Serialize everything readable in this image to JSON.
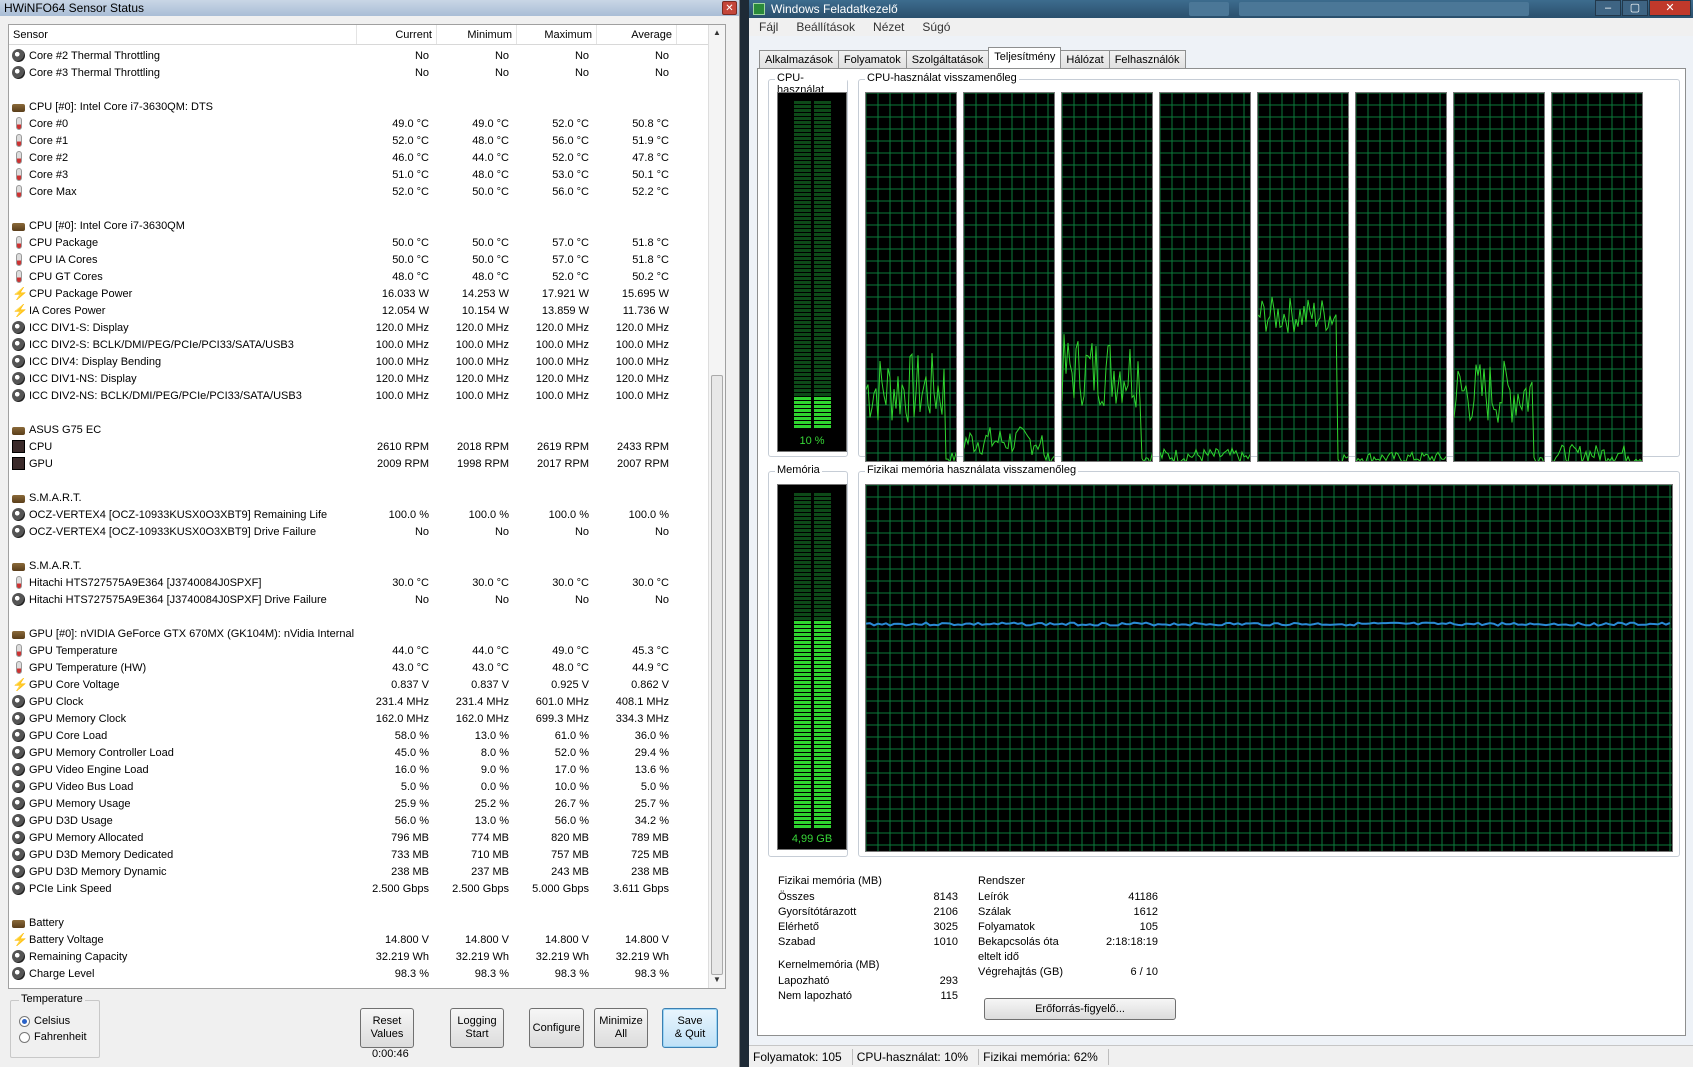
{
  "hwinfo": {
    "title": "HWiNFO64 Sensor Status",
    "columns": [
      "Sensor",
      "Current",
      "Minimum",
      "Maximum",
      "Average"
    ],
    "rows": [
      {
        "icon": "gauge",
        "name": "Core #2 Thermal Throttling",
        "cur": "No",
        "min": "No",
        "max": "No",
        "avg": "No"
      },
      {
        "icon": "gauge",
        "name": "Core #3 Thermal Throttling",
        "cur": "No",
        "min": "No",
        "max": "No",
        "avg": "No"
      },
      {
        "blank": true
      },
      {
        "icon": "chip",
        "name": "CPU [#0]: Intel Core i7-3630QM: DTS"
      },
      {
        "icon": "therm",
        "name": "Core #0",
        "cur": "49.0 °C",
        "min": "49.0 °C",
        "max": "52.0 °C",
        "avg": "50.8 °C"
      },
      {
        "icon": "therm",
        "name": "Core #1",
        "cur": "52.0 °C",
        "min": "48.0 °C",
        "max": "56.0 °C",
        "avg": "51.9 °C"
      },
      {
        "icon": "therm",
        "name": "Core #2",
        "cur": "46.0 °C",
        "min": "44.0 °C",
        "max": "52.0 °C",
        "avg": "47.8 °C"
      },
      {
        "icon": "therm",
        "name": "Core #3",
        "cur": "51.0 °C",
        "min": "48.0 °C",
        "max": "53.0 °C",
        "avg": "50.1 °C"
      },
      {
        "icon": "therm",
        "name": "Core Max",
        "cur": "52.0 °C",
        "min": "50.0 °C",
        "max": "56.0 °C",
        "avg": "52.2 °C"
      },
      {
        "blank": true
      },
      {
        "icon": "chip",
        "name": "CPU [#0]: Intel Core i7-3630QM"
      },
      {
        "icon": "therm",
        "name": "CPU Package",
        "cur": "50.0 °C",
        "min": "50.0 °C",
        "max": "57.0 °C",
        "avg": "51.8 °C"
      },
      {
        "icon": "therm",
        "name": "CPU IA Cores",
        "cur": "50.0 °C",
        "min": "50.0 °C",
        "max": "57.0 °C",
        "avg": "51.8 °C"
      },
      {
        "icon": "therm",
        "name": "CPU GT Cores",
        "cur": "48.0 °C",
        "min": "48.0 °C",
        "max": "52.0 °C",
        "avg": "50.2 °C"
      },
      {
        "icon": "bolt",
        "name": "CPU Package Power",
        "cur": "16.033 W",
        "min": "14.253 W",
        "max": "17.921 W",
        "avg": "15.695 W"
      },
      {
        "icon": "bolt",
        "name": "IA Cores Power",
        "cur": "12.054 W",
        "min": "10.154 W",
        "max": "13.859 W",
        "avg": "11.736 W"
      },
      {
        "icon": "gauge",
        "name": "ICC DIV1-S: Display",
        "cur": "120.0 MHz",
        "min": "120.0 MHz",
        "max": "120.0 MHz",
        "avg": "120.0 MHz"
      },
      {
        "icon": "gauge",
        "name": "ICC DIV2-S: BCLK/DMI/PEG/PCIe/PCI33/SATA/USB3",
        "cur": "100.0 MHz",
        "min": "100.0 MHz",
        "max": "100.0 MHz",
        "avg": "100.0 MHz"
      },
      {
        "icon": "gauge",
        "name": "ICC DIV4: Display Bending",
        "cur": "100.0 MHz",
        "min": "100.0 MHz",
        "max": "100.0 MHz",
        "avg": "100.0 MHz"
      },
      {
        "icon": "gauge",
        "name": "ICC DIV1-NS: Display",
        "cur": "120.0 MHz",
        "min": "120.0 MHz",
        "max": "120.0 MHz",
        "avg": "120.0 MHz"
      },
      {
        "icon": "gauge",
        "name": "ICC DIV2-NS: BCLK/DMI/PEG/PCIe/PCI33/SATA/USB3",
        "cur": "100.0 MHz",
        "min": "100.0 MHz",
        "max": "100.0 MHz",
        "avg": "100.0 MHz"
      },
      {
        "blank": true
      },
      {
        "icon": "chip",
        "name": "ASUS G75 EC"
      },
      {
        "icon": "fan",
        "name": "CPU",
        "cur": "2610 RPM",
        "min": "2018 RPM",
        "max": "2619 RPM",
        "avg": "2433 RPM"
      },
      {
        "icon": "fan",
        "name": "GPU",
        "cur": "2009 RPM",
        "min": "1998 RPM",
        "max": "2017 RPM",
        "avg": "2007 RPM"
      },
      {
        "blank": true
      },
      {
        "icon": "chip",
        "name": "S.M.A.R.T."
      },
      {
        "icon": "gauge",
        "name": "OCZ-VERTEX4 [OCZ-10933KUSX0O3XBT9] Remaining Life",
        "cur": "100.0 %",
        "min": "100.0 %",
        "max": "100.0 %",
        "avg": "100.0 %"
      },
      {
        "icon": "gauge",
        "name": "OCZ-VERTEX4 [OCZ-10933KUSX0O3XBT9] Drive Failure",
        "cur": "No",
        "min": "No",
        "max": "No",
        "avg": "No"
      },
      {
        "blank": true
      },
      {
        "icon": "chip",
        "name": "S.M.A.R.T."
      },
      {
        "icon": "therm",
        "name": "Hitachi HTS727575A9E364 [J3740084J0SPXF]",
        "cur": "30.0 °C",
        "min": "30.0 °C",
        "max": "30.0 °C",
        "avg": "30.0 °C"
      },
      {
        "icon": "gauge",
        "name": "Hitachi HTS727575A9E364 [J3740084J0SPXF] Drive Failure",
        "cur": "No",
        "min": "No",
        "max": "No",
        "avg": "No"
      },
      {
        "blank": true
      },
      {
        "icon": "chip",
        "name": "GPU [#0]: nVIDIA GeForce GTX 670MX (GK104M): nVidia Internal"
      },
      {
        "icon": "therm",
        "name": "GPU Temperature",
        "cur": "44.0 °C",
        "min": "44.0 °C",
        "max": "49.0 °C",
        "avg": "45.3 °C"
      },
      {
        "icon": "therm",
        "name": "GPU Temperature (HW)",
        "cur": "43.0 °C",
        "min": "43.0 °C",
        "max": "48.0 °C",
        "avg": "44.9 °C"
      },
      {
        "icon": "bolt",
        "name": "GPU Core Voltage",
        "cur": "0.837 V",
        "min": "0.837 V",
        "max": "0.925 V",
        "avg": "0.862 V"
      },
      {
        "icon": "gauge",
        "name": "GPU Clock",
        "cur": "231.4 MHz",
        "min": "231.4 MHz",
        "max": "601.0 MHz",
        "avg": "408.1 MHz"
      },
      {
        "icon": "gauge",
        "name": "GPU Memory Clock",
        "cur": "162.0 MHz",
        "min": "162.0 MHz",
        "max": "699.3 MHz",
        "avg": "334.3 MHz"
      },
      {
        "icon": "gauge",
        "name": "GPU Core Load",
        "cur": "58.0 %",
        "min": "13.0 %",
        "max": "61.0 %",
        "avg": "36.0 %"
      },
      {
        "icon": "gauge",
        "name": "GPU Memory Controller Load",
        "cur": "45.0 %",
        "min": "8.0 %",
        "max": "52.0 %",
        "avg": "29.4 %"
      },
      {
        "icon": "gauge",
        "name": "GPU Video Engine Load",
        "cur": "16.0 %",
        "min": "9.0 %",
        "max": "17.0 %",
        "avg": "13.6 %"
      },
      {
        "icon": "gauge",
        "name": "GPU Video Bus Load",
        "cur": "5.0 %",
        "min": "0.0 %",
        "max": "10.0 %",
        "avg": "5.0 %"
      },
      {
        "icon": "gauge",
        "name": "GPU Memory Usage",
        "cur": "25.9 %",
        "min": "25.2 %",
        "max": "26.7 %",
        "avg": "25.7 %"
      },
      {
        "icon": "gauge",
        "name": "GPU D3D Usage",
        "cur": "56.0 %",
        "min": "13.0 %",
        "max": "56.0 %",
        "avg": "34.2 %"
      },
      {
        "icon": "gauge",
        "name": "GPU Memory Allocated",
        "cur": "796 MB",
        "min": "774 MB",
        "max": "820 MB",
        "avg": "789 MB"
      },
      {
        "icon": "gauge",
        "name": "GPU D3D Memory Dedicated",
        "cur": "733 MB",
        "min": "710 MB",
        "max": "757 MB",
        "avg": "725 MB"
      },
      {
        "icon": "gauge",
        "name": "GPU D3D Memory Dynamic",
        "cur": "238 MB",
        "min": "237 MB",
        "max": "243 MB",
        "avg": "238 MB"
      },
      {
        "icon": "gauge",
        "name": "PCIe Link Speed",
        "cur": "2.500 Gbps",
        "min": "2.500 Gbps",
        "max": "5.000 Gbps",
        "avg": "3.611 Gbps"
      },
      {
        "blank": true
      },
      {
        "icon": "chip",
        "name": "Battery"
      },
      {
        "icon": "bolt",
        "name": "Battery Voltage",
        "cur": "14.800 V",
        "min": "14.800 V",
        "max": "14.800 V",
        "avg": "14.800 V"
      },
      {
        "icon": "gauge",
        "name": "Remaining Capacity",
        "cur": "32.219 Wh",
        "min": "32.219 Wh",
        "max": "32.219 Wh",
        "avg": "32.219 Wh"
      },
      {
        "icon": "gauge",
        "name": "Charge Level",
        "cur": "98.3 %",
        "min": "98.3 %",
        "max": "98.3 %",
        "avg": "98.3 %"
      }
    ],
    "temperature": {
      "label": "Temperature",
      "celsius": "Celsius",
      "fahrenheit": "Fahrenheit"
    },
    "buttons": {
      "reset": "Reset\nValues",
      "logging": "Logging\nStart",
      "configure": "Configure",
      "minimize": "Minimize\nAll",
      "save": "Save\n& Quit"
    },
    "timer": "0:00:46"
  },
  "taskmanager": {
    "title": "Windows Feladatkezelő",
    "menu": [
      "Fájl",
      "Beállítások",
      "Nézet",
      "Súgó"
    ],
    "tabs": [
      "Alkalmazások",
      "Folyamatok",
      "Szolgáltatások",
      "Teljesítmény",
      "Hálózat",
      "Felhasználók"
    ],
    "active_tab": "Teljesítmény",
    "cpu_usage_label": "CPU-használat",
    "cpu_usage_value": "10 %",
    "cpu_usage_fraction": 0.1,
    "cpu_history_label": "CPU-használat visszamenőleg",
    "memory_label": "Memória",
    "memory_value": "4,99 GB",
    "memory_fraction": 0.62,
    "memory_history_label": "Fizikai memória használata visszamenőleg",
    "physical_memory": {
      "header": "Fizikai memória (MB)",
      "items": [
        {
          "k": "Összes",
          "v": "8143"
        },
        {
          "k": "Gyorsítótárazott",
          "v": "2106"
        },
        {
          "k": "Elérhető",
          "v": "3025"
        },
        {
          "k": "Szabad",
          "v": "1010"
        }
      ]
    },
    "kernel_memory": {
      "header": "Kernelmemória (MB)",
      "items": [
        {
          "k": "Lapozható",
          "v": "293"
        },
        {
          "k": "Nem lapozható",
          "v": "115"
        }
      ]
    },
    "system": {
      "header": "Rendszer",
      "items": [
        {
          "k": "Leírók",
          "v": "41186"
        },
        {
          "k": "Szálak",
          "v": "1612"
        },
        {
          "k": "Folyamatok",
          "v": "105"
        },
        {
          "k": "Bekapcsolás óta",
          "v": "2:18:18:19"
        },
        {
          "k": "eltelt idő",
          "v": ""
        },
        {
          "k": "Végrehajtás (GB)",
          "v": "6 / 10"
        }
      ]
    },
    "resource_monitor_button": "Erőforrás-figyelő...",
    "status": {
      "processes": "Folyamatok: 105",
      "cpu": "CPU-használat: 10%",
      "memory": "Fizikai memória: 62%"
    },
    "colors": {
      "graph_green": "#2fd42f",
      "grid": "#0b7a3a",
      "memory_line": "#2a8ad4"
    }
  }
}
